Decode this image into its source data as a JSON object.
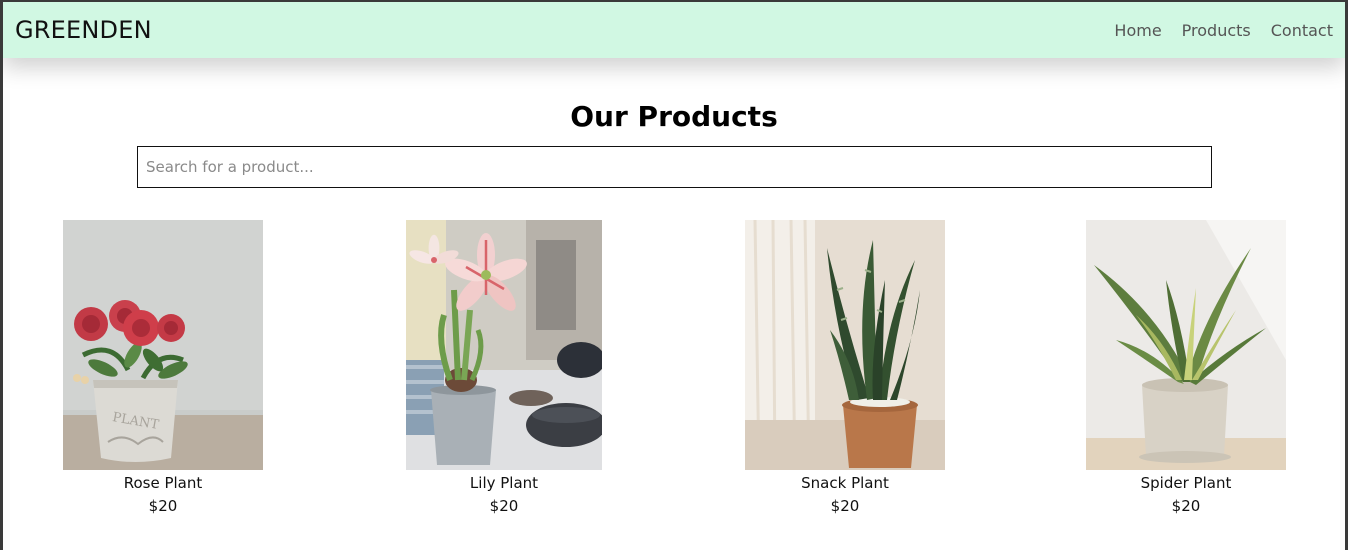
{
  "navbar": {
    "brand": "GREENDEN",
    "links": [
      {
        "label": "Home"
      },
      {
        "label": "Products"
      },
      {
        "label": "Contact"
      }
    ]
  },
  "main": {
    "title": "Our Products",
    "search_placeholder": "Search for a product..."
  },
  "products": [
    {
      "name": "Rose Plant",
      "price": "$20",
      "image": "rose-plant-photo"
    },
    {
      "name": "Lily Plant",
      "price": "$20",
      "image": "lily-plant-photo"
    },
    {
      "name": "Snack Plant",
      "price": "$20",
      "image": "snake-plant-photo"
    },
    {
      "name": "Spider Plant",
      "price": "$20",
      "image": "spider-plant-photo"
    }
  ],
  "colors": {
    "navbar_bg": "#d1f8e3",
    "text": "#111111",
    "nav_link": "#555555"
  }
}
